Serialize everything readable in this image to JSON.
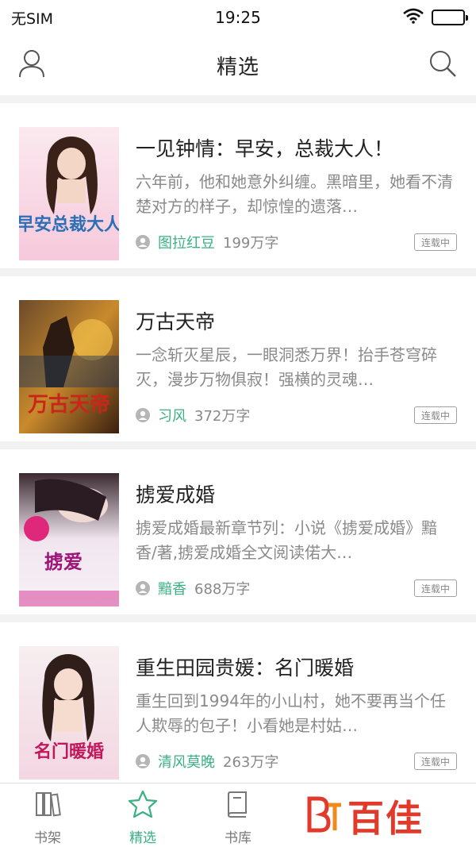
{
  "status_bar": {
    "carrier": "无SIM",
    "time": "19:25"
  },
  "nav": {
    "title": "精选"
  },
  "books": [
    {
      "title": "一见钟情：早安，总裁大人！",
      "description": "六年前，他和她意外纠缠。黑暗里，她看不清楚对方的样子，却惊惶的遗落…",
      "author": "图拉红豆",
      "word_count": "199万字",
      "status": "连载中",
      "cover_text": "早安总裁大人"
    },
    {
      "title": "万古天帝",
      "description": "一念斩灭星辰，一眼洞悉万界！抬手苍穹碎灭，漫步万物俱寂！强横的灵魂…",
      "author": "习风",
      "word_count": "372万字",
      "status": "连载中",
      "cover_text": "万古天帝"
    },
    {
      "title": "掳爱成婚",
      "description": "掳爱成婚最新章节列：小说《掳爱成婚》黯香/著,掳爱成婚全文阅读偌大…",
      "author": "黯香",
      "word_count": "688万字",
      "status": "连载中",
      "cover_text": "掳爱"
    },
    {
      "title": "重生田园贵媛：名门暖婚",
      "description": "重生回到1994年的小山村，她不要再当个任人欺辱的包子！小看她是村姑…",
      "author": "清风莫晚",
      "word_count": "263万字",
      "status": "连载中",
      "cover_text": "名门暖婚"
    }
  ],
  "tabs": [
    {
      "label": "书架",
      "icon": "bookshelf-icon",
      "active": false
    },
    {
      "label": "精选",
      "icon": "star-icon",
      "active": true
    },
    {
      "label": "书库",
      "icon": "library-icon",
      "active": false
    }
  ],
  "brand": {
    "text": "百佳"
  },
  "colors": {
    "accent": "#3bb082",
    "brand": "#e23a2a",
    "separator": "#f2f2f2"
  }
}
